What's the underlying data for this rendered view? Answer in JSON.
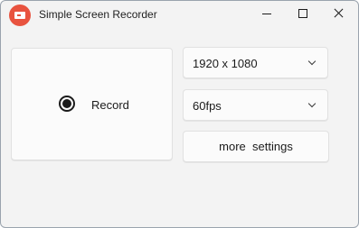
{
  "window": {
    "title": "Simple Screen Recorder",
    "app_icon": "screen-recorder-app-icon",
    "accent_color": "#e8533f",
    "controls": {
      "minimize_icon": "minimize-icon",
      "maximize_icon": "maximize-icon",
      "close_icon": "close-icon"
    }
  },
  "record": {
    "label": "Record",
    "selected": true
  },
  "resolution": {
    "value": "1920 x 1080",
    "icon": "chevron-down-icon"
  },
  "framerate": {
    "value": "60fps",
    "icon": "chevron-down-icon"
  },
  "more_settings": {
    "label": "more  settings"
  }
}
